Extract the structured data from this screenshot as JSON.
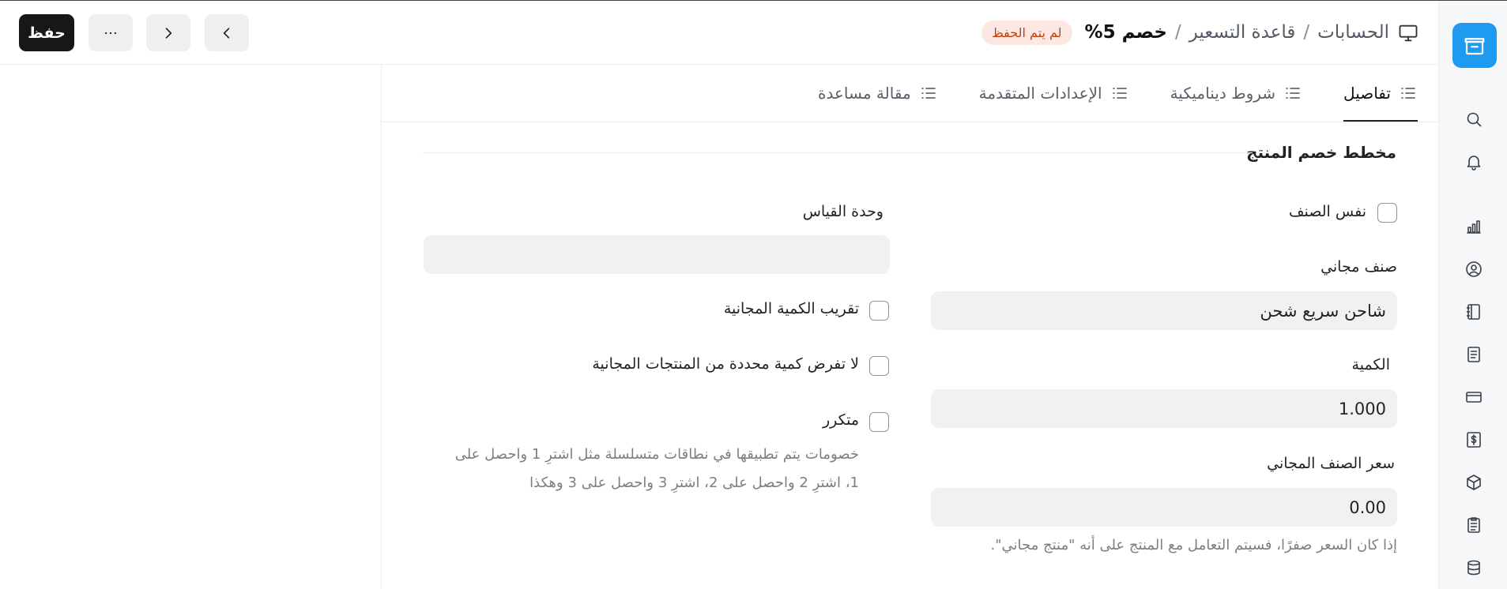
{
  "header": {
    "breadcrumbs": [
      "الحسابات",
      "قاعدة التسعير",
      "خصم 5%"
    ],
    "status_badge": "لم يتم الحفظ",
    "save_label": "حفظ"
  },
  "tabs": [
    {
      "label": "تفاصيل",
      "active": true
    },
    {
      "label": "شروط ديناميكية",
      "active": false
    },
    {
      "label": "الإعدادات المتقدمة",
      "active": false
    },
    {
      "label": "مقالة مساعدة",
      "active": false
    }
  ],
  "section": {
    "title": "مخطط خصم المنتج",
    "same_item_label": "نفس الصنف",
    "free_item_label": "صنف مجاني",
    "free_item_value": "شاحن سريع شحن",
    "qty_label": "الكمية",
    "qty_value": "1.000",
    "free_price_label": "سعر الصنف المجاني",
    "free_price_value": "0.00",
    "free_price_help": "إذا كان السعر صفرًا، فسيتم التعامل مع المنتج على أنه \"منتج مجاني\".",
    "uom_label": "وحدة القياس",
    "uom_value": "",
    "round_free_qty_label": "تقريب الكمية المجانية",
    "no_fixed_qty_label": "لا تفرض كمية محددة من المنتجات المجانية",
    "recursive_label": "متكرر",
    "recursive_help_1": "خصومات يتم تطبيقها في نطاقات متسلسلة مثل اشترِ 1 واحصل على",
    "recursive_help_2": "1، اشترِ 2 واحصل على 2، اشترِ 3 واحصل على 3 وهكذا"
  },
  "colors": {
    "accent": "#1e9bf0",
    "badge_bg": "#fde7e3",
    "badge_text": "#c2410c",
    "primary_button": "#171717"
  },
  "sidebar_icons": [
    "app-logo-icon",
    "search-icon",
    "bell-icon",
    "bar-chart-icon",
    "user-circle-icon",
    "notebook-icon",
    "document-icon",
    "card-icon",
    "dollar-icon",
    "box-icon",
    "clipboard-icon",
    "database-icon"
  ]
}
